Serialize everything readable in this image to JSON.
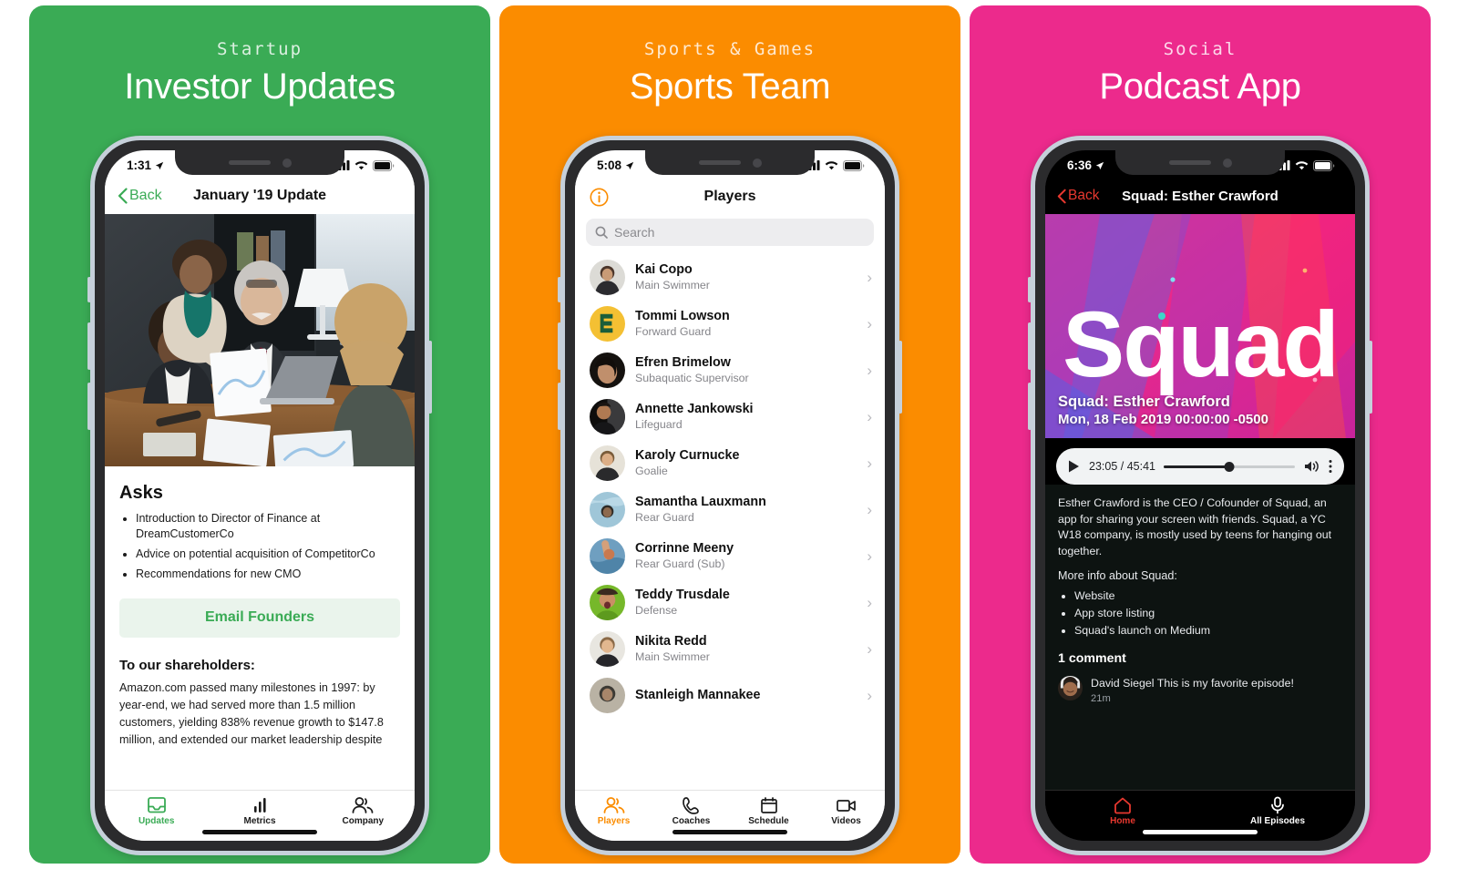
{
  "panels": [
    {
      "category": "Startup",
      "title": "Investor Updates",
      "accent": "#3AAB55",
      "phone": {
        "status": {
          "time": "1:31",
          "location_icon": "location-arrow-icon",
          "signal_icon": "cellular-signal-icon",
          "wifi_icon": "wifi-icon",
          "battery_icon": "battery-icon"
        },
        "nav": {
          "back_label": "Back",
          "title": "January '19 Update"
        },
        "hero_image_alt": "business-meeting-photo",
        "asks_heading": "Asks",
        "asks": [
          "Introduction to Director of Finance at DreamCustomerCo",
          "Advice on potential acquisition of CompetitorCo",
          "Recommendations for new CMO"
        ],
        "email_button": "Email Founders",
        "shareholders_heading": "To our shareholders:",
        "shareholders_body": "Amazon.com passed many milestones in 1997: by year-end, we had served more than 1.5 million customers, yielding 838% revenue growth to $147.8 million, and extended our market leadership despite",
        "tabs": [
          {
            "label": "Updates",
            "icon": "inbox-tray-icon",
            "active": true
          },
          {
            "label": "Metrics",
            "icon": "bar-chart-icon",
            "active": false
          },
          {
            "label": "Company",
            "icon": "people-icon",
            "active": false
          }
        ]
      }
    },
    {
      "category": "Sports & Games",
      "title": "Sports Team",
      "accent": "#FB8C00",
      "phone": {
        "status": {
          "time": "5:08",
          "location_icon": "location-arrow-icon",
          "signal_icon": "cellular-signal-icon",
          "wifi_icon": "wifi-icon",
          "battery_icon": "battery-icon"
        },
        "nav": {
          "info_icon": "info-circle-icon",
          "title": "Players"
        },
        "search_placeholder": "Search",
        "players": [
          {
            "name": "Kai Copo",
            "role": "Main Swimmer"
          },
          {
            "name": "Tommi Lowson",
            "role": "Forward Guard"
          },
          {
            "name": "Efren Brimelow",
            "role": "Subaquatic Supervisor"
          },
          {
            "name": "Annette Jankowski",
            "role": "Lifeguard"
          },
          {
            "name": "Karoly Curnucke",
            "role": "Goalie"
          },
          {
            "name": "Samantha Lauxmann",
            "role": "Rear Guard"
          },
          {
            "name": "Corrinne Meeny",
            "role": "Rear Guard (Sub)"
          },
          {
            "name": "Teddy Trusdale",
            "role": "Defense"
          },
          {
            "name": "Nikita Redd",
            "role": "Main Swimmer"
          },
          {
            "name": "Stanleigh Mannakee",
            "role": ""
          }
        ],
        "tabs": [
          {
            "label": "Players",
            "icon": "people-icon",
            "active": true
          },
          {
            "label": "Coaches",
            "icon": "phone-icon",
            "active": false
          },
          {
            "label": "Schedule",
            "icon": "calendar-icon",
            "active": false
          },
          {
            "label": "Videos",
            "icon": "video-camera-icon",
            "active": false
          }
        ]
      }
    },
    {
      "category": "Social",
      "title": "Podcast App",
      "accent": "#EC2A8C",
      "phone": {
        "status": {
          "time": "6:36",
          "location_icon": "location-arrow-icon",
          "signal_icon": "cellular-signal-icon",
          "wifi_icon": "wifi-icon",
          "battery_icon": "battery-icon"
        },
        "nav": {
          "back_label": "Back",
          "title": "Squad: Esther Crawford"
        },
        "artwork_text": "Squad",
        "episode_title": "Squad: Esther Crawford",
        "episode_date": "Mon, 18 Feb 2019 00:00:00 -0500",
        "player": {
          "play_icon": "play-icon",
          "time": "23:05 / 45:41",
          "progress_percent": 50,
          "volume_icon": "volume-icon",
          "more_icon": "kebab-menu-icon"
        },
        "description": "Esther Crawford is the CEO / Cofounder of Squad, an app for sharing your screen with friends. Squad, a YC W18 company, is mostly used by teens for hanging out together.",
        "more_info_label": "More info about Squad:",
        "links": [
          "Website",
          "App store listing",
          "Squad's launch on Medium"
        ],
        "comment_count": "1 comment",
        "comment": {
          "text": "David Siegel This is my favorite episode!",
          "time": "21m"
        },
        "tabs": [
          {
            "label": "Home",
            "icon": "home-icon",
            "active": true
          },
          {
            "label": "All Episodes",
            "icon": "microphone-icon",
            "active": false
          }
        ]
      }
    }
  ]
}
